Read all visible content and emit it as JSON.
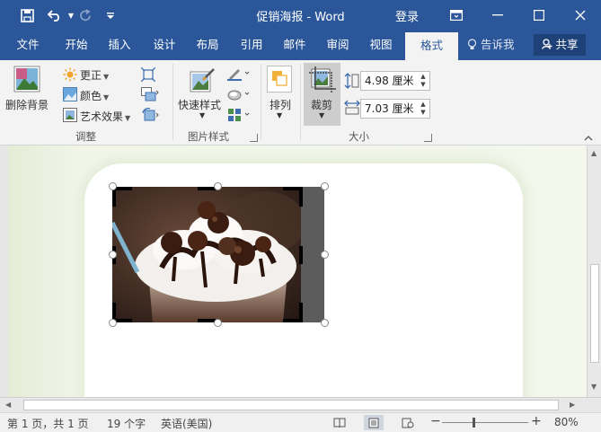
{
  "window": {
    "title": "促销海报  -  Word",
    "login": "登录"
  },
  "tabs": [
    "文件",
    "开始",
    "插入",
    "设计",
    "布局",
    "引用",
    "邮件",
    "审阅",
    "视图",
    "格式"
  ],
  "active_tab": "格式",
  "tell_me": "告诉我",
  "share": "共享",
  "ribbon": {
    "remove_bg": "删除背景",
    "corrections": "更正",
    "color": "颜色",
    "artistic": "艺术效果",
    "adjust_group": "调整",
    "quick_styles": "快速样式",
    "picture_styles_group": "图片样式",
    "arrange": "排列",
    "crop": "裁剪",
    "height_value": "4.98 厘米",
    "width_value": "7.03 厘米",
    "size_group": "大小"
  },
  "status": {
    "page": "第 1 页，共 1 页",
    "words": "19 个字",
    "language": "英语(美国)",
    "zoom": "80%"
  },
  "colors": {
    "accent": "#2b579a",
    "ribbon_bg": "#f3f3f3",
    "page_tint": "#eef3e6"
  }
}
